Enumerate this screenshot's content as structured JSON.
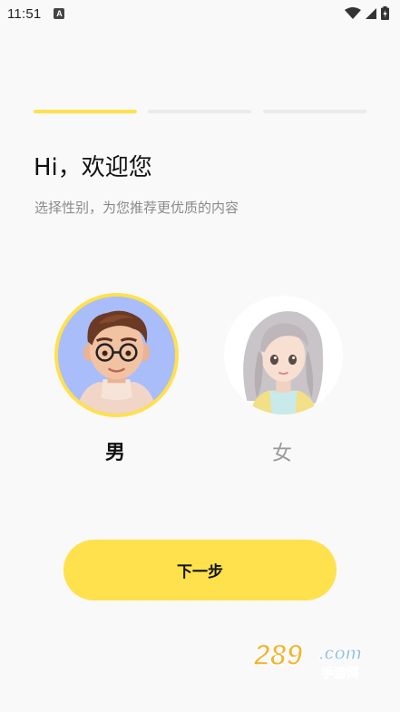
{
  "status_bar": {
    "time": "11:51",
    "notification_icon": "a-letter-icon",
    "icons": [
      "wifi-icon",
      "cellular-signal-icon",
      "battery-charging-icon"
    ]
  },
  "onboarding": {
    "progress": {
      "total_steps": 3,
      "current_step": 1
    },
    "greeting": "Hi，欢迎您",
    "subtitle": "选择性别，为您推荐更优质的内容",
    "options": [
      {
        "label": "男",
        "selected": true
      },
      {
        "label": "女",
        "selected": false
      }
    ],
    "next_button": "下一步"
  },
  "watermark": {
    "number": "289",
    "suffix": ".com",
    "caption": "手游网"
  },
  "colors": {
    "accent": "#ffe14d",
    "background": "#f9f9f9",
    "inactive_track": "#ebebeb",
    "subtitle_text": "#8a8a8a",
    "male_avatar_bg": "#a9bdfb"
  }
}
